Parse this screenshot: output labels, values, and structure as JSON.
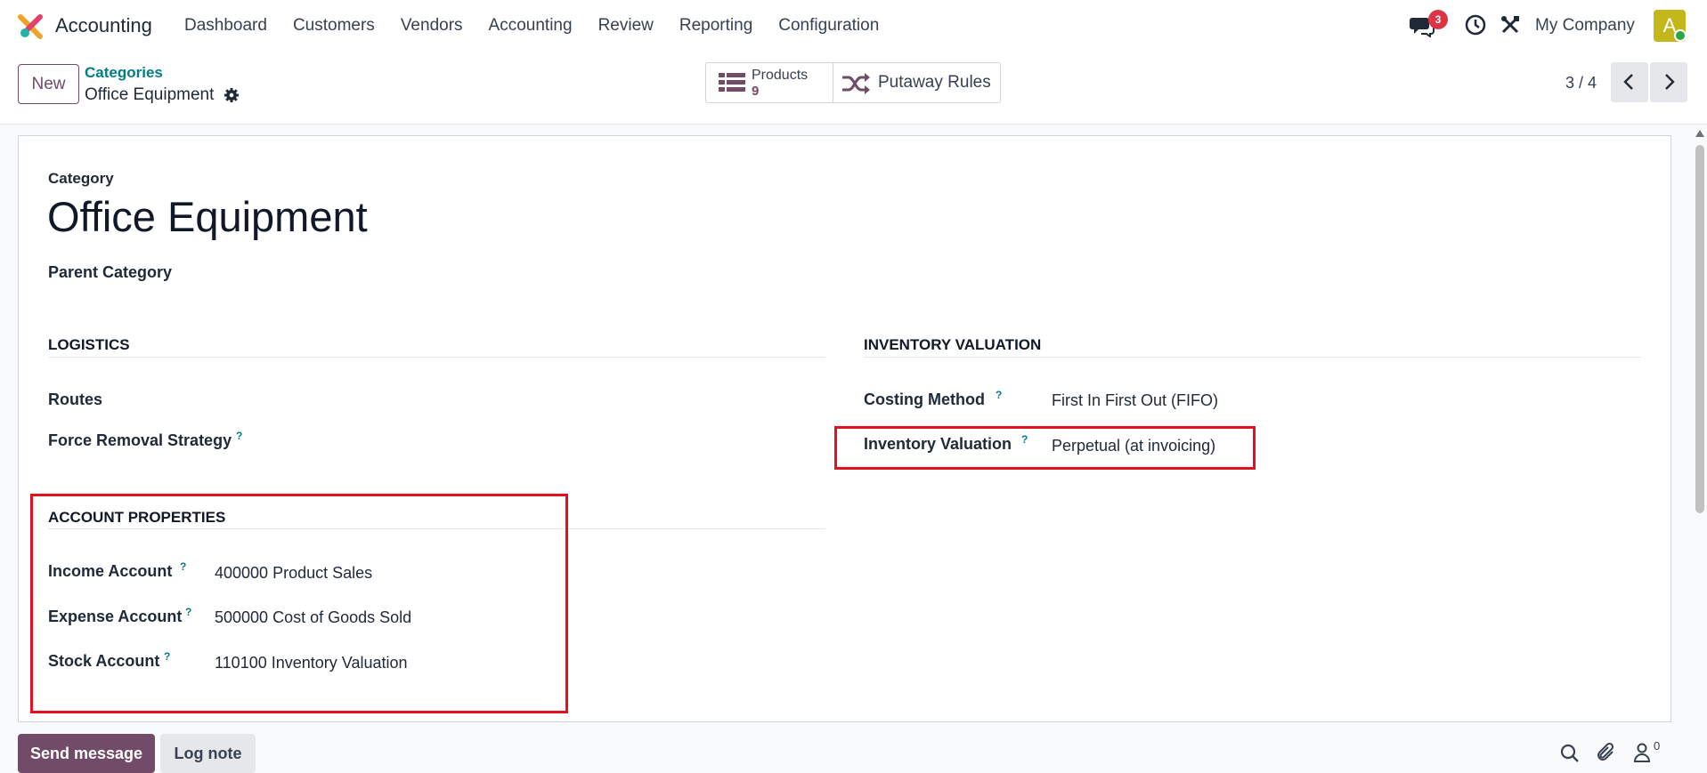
{
  "app": {
    "name": "Accounting"
  },
  "menu": [
    "Dashboard",
    "Customers",
    "Vendors",
    "Accounting",
    "Review",
    "Reporting",
    "Configuration"
  ],
  "systray": {
    "chat_badge": "3",
    "company": "My Company",
    "avatar_letter": "A"
  },
  "control": {
    "new_label": "New",
    "breadcrumb_parent": "Categories",
    "breadcrumb_current": "Office Equipment",
    "products_label": "Products",
    "products_count": "9",
    "putaway_label": "Putaway Rules",
    "pager": "3 / 4"
  },
  "form": {
    "category_label": "Category",
    "category_name": "Office Equipment",
    "parent_label": "Parent Category",
    "logistics": {
      "title": "LOGISTICS",
      "routes_label": "Routes",
      "removal_label": "Force Removal Strategy"
    },
    "valuation": {
      "title": "INVENTORY VALUATION",
      "costing_label": "Costing Method",
      "costing_value": "First In First Out (FIFO)",
      "inv_label": "Inventory Valuation",
      "inv_value": "Perpetual (at invoicing)"
    },
    "accounts": {
      "title": "ACCOUNT PROPERTIES",
      "income_label": "Income Account",
      "income_value": "400000 Product Sales",
      "expense_label": "Expense Account",
      "expense_value": "500000 Cost of Goods Sold",
      "stock_label": "Stock Account",
      "stock_value": "110100 Inventory Valuation"
    },
    "help_mark": "?"
  },
  "chatter": {
    "send_label": "Send message",
    "log_label": "Log note",
    "follower_count": "0"
  },
  "colors": {
    "brand": "#714b67",
    "teal": "#017e84",
    "highlight": "#e4101e"
  }
}
